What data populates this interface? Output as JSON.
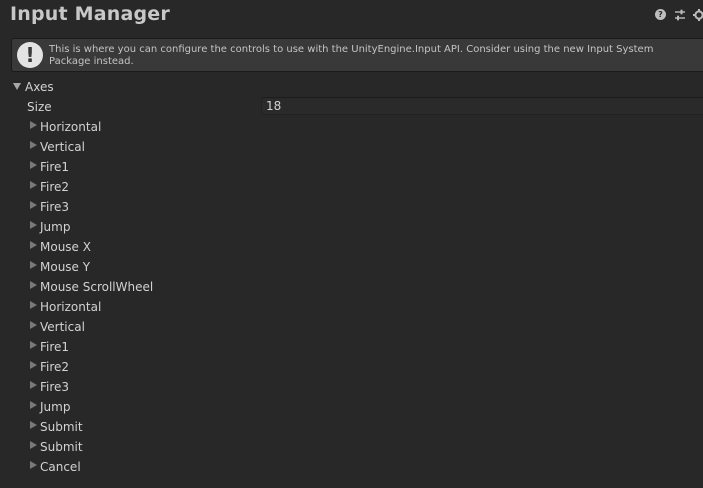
{
  "window": {
    "title": "Input Manager",
    "icons": [
      "help-icon",
      "presets-icon",
      "settings-gear-icon"
    ]
  },
  "info": {
    "icon": "warning-icon",
    "message": "This is where you can configure the controls to use with the UnityEngine.Input API. Consider using the new Input System Package instead."
  },
  "axes": {
    "label": "Axes",
    "size_label": "Size",
    "size_value": "18",
    "items": [
      {
        "label": "Horizontal"
      },
      {
        "label": "Vertical"
      },
      {
        "label": "Fire1"
      },
      {
        "label": "Fire2"
      },
      {
        "label": "Fire3"
      },
      {
        "label": "Jump"
      },
      {
        "label": "Mouse X"
      },
      {
        "label": "Mouse Y"
      },
      {
        "label": "Mouse ScrollWheel"
      },
      {
        "label": "Horizontal"
      },
      {
        "label": "Vertical"
      },
      {
        "label": "Fire1"
      },
      {
        "label": "Fire2"
      },
      {
        "label": "Fire3"
      },
      {
        "label": "Jump"
      },
      {
        "label": "Submit"
      },
      {
        "label": "Submit"
      },
      {
        "label": "Cancel"
      }
    ]
  }
}
